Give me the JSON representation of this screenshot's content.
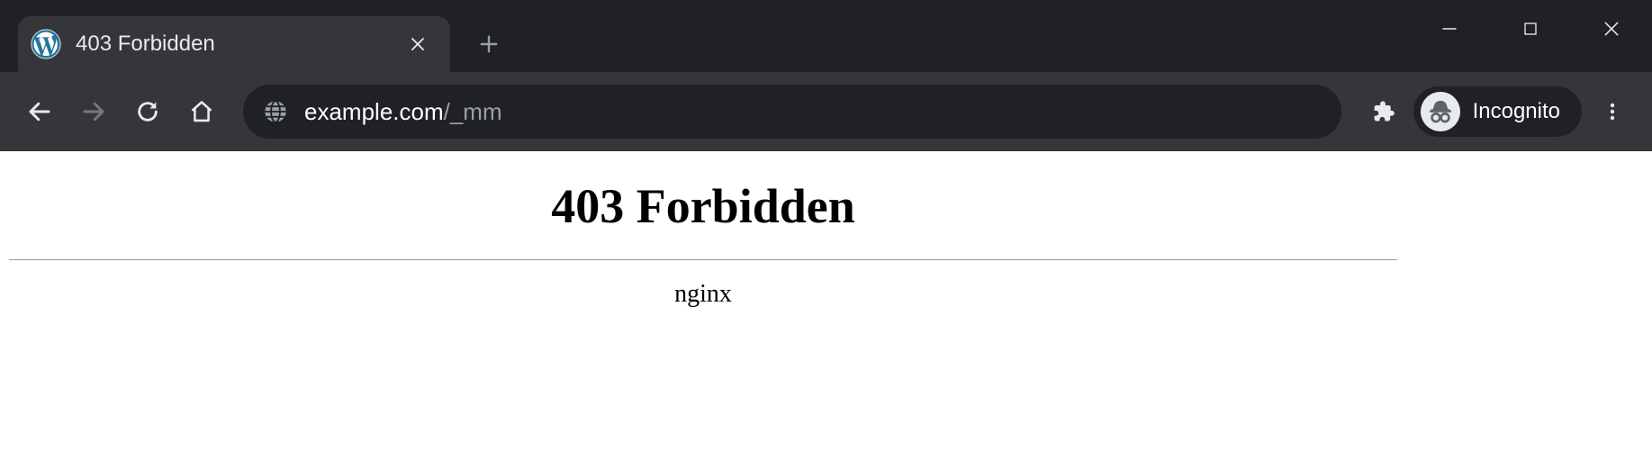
{
  "tab": {
    "title": "403 Forbidden"
  },
  "toolbar": {
    "url_host": "example.com",
    "url_path": "/_mm",
    "incognito_label": "Incognito"
  },
  "page": {
    "heading": "403 Forbidden",
    "server": "nginx"
  }
}
